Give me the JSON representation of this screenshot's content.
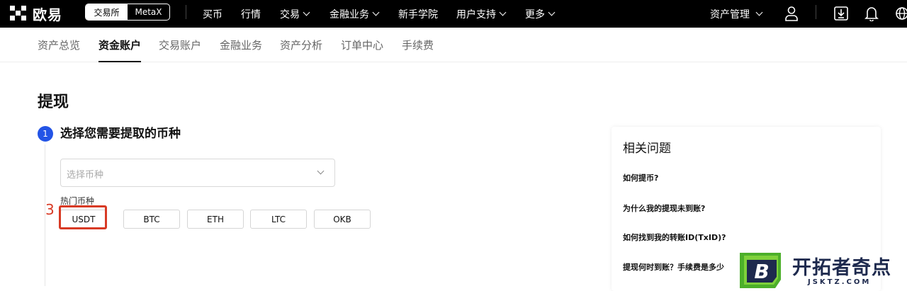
{
  "topbar": {
    "logo_text": "欧易",
    "segment": [
      "交易所",
      "MetaX"
    ],
    "nav": [
      {
        "label": "买币",
        "dropdown": false
      },
      {
        "label": "行情",
        "dropdown": false
      },
      {
        "label": "交易",
        "dropdown": true
      },
      {
        "label": "金融业务",
        "dropdown": true
      },
      {
        "label": "新手学院",
        "dropdown": false
      },
      {
        "label": "用户支持",
        "dropdown": true
      },
      {
        "label": "更多",
        "dropdown": true
      }
    ],
    "asset_management": "资产管理",
    "icons": [
      "user-icon",
      "download-icon",
      "bell-icon",
      "globe-icon"
    ]
  },
  "subnav": {
    "items": [
      "资产总览",
      "资金账户",
      "交易账户",
      "金融业务",
      "资产分析",
      "订单中心",
      "手续费"
    ],
    "active_index": 1
  },
  "main": {
    "title": "提现",
    "step": {
      "number": "1",
      "title": "选择您需要提取的币种"
    },
    "select_placeholder": "选择币种",
    "hot_label": "热门币种",
    "coins": [
      "USDT",
      "BTC",
      "ETH",
      "LTC",
      "OKB"
    ],
    "annotation_number": "3",
    "highlight_color": "#d83a25"
  },
  "faq": {
    "title": "相关问题",
    "items": [
      "如何提币?",
      "为什么我的提现未到账?",
      "如何找到我的转账ID(TxID)?",
      "提现何时到账？手续费是多少"
    ]
  },
  "watermark": {
    "logo_letter": "B",
    "text": "开拓者奇点",
    "sub": "JSKTZ.COM"
  },
  "colors": {
    "accent": "#2354e6",
    "topbar_bg": "#000000",
    "annotation": "#d83a25"
  }
}
